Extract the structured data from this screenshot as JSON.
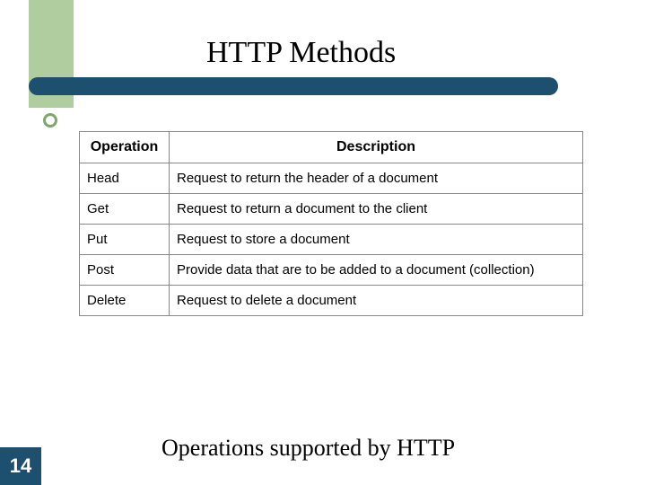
{
  "slide": {
    "title": "HTTP Methods",
    "caption": "Operations supported by HTTP",
    "page_number": "14"
  },
  "table": {
    "headers": {
      "operation": "Operation",
      "description": "Description"
    },
    "rows": [
      {
        "operation": "Head",
        "description": "Request to return the header of a document"
      },
      {
        "operation": "Get",
        "description": "Request to return a document to the client"
      },
      {
        "operation": "Put",
        "description": "Request to store a document"
      },
      {
        "operation": "Post",
        "description": "Provide data that are to be added to a document (collection)"
      },
      {
        "operation": "Delete",
        "description": "Request to delete a document"
      }
    ]
  }
}
